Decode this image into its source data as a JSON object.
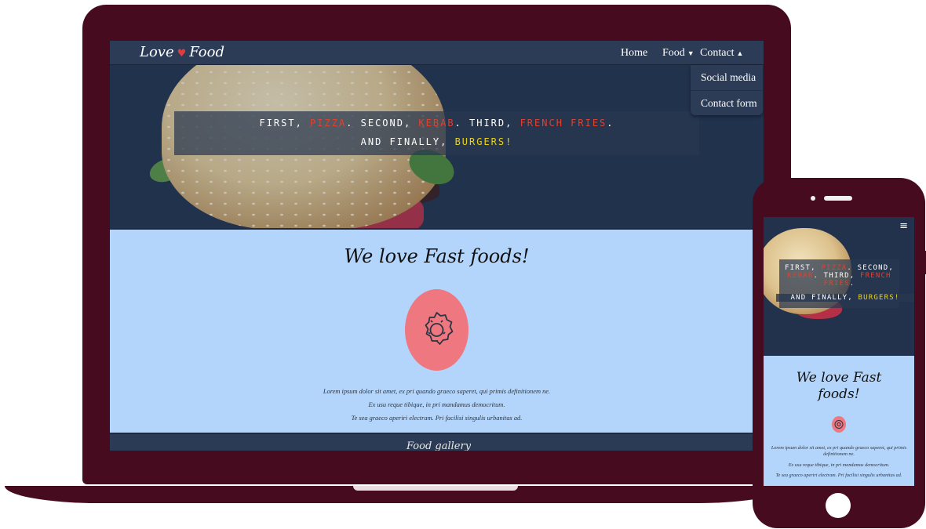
{
  "brand": {
    "left": "Love",
    "heart": "♥",
    "right": "Food"
  },
  "nav": {
    "home": "Home",
    "food": "Food",
    "contact": "Contact",
    "dropdown": [
      "Social media",
      "Contact form"
    ]
  },
  "hero": {
    "quote": {
      "first": "FIRST, ",
      "pizza": "PIZZA",
      "second": ". SECOND, ",
      "kebab": "KEBAB",
      "third": ". THIRD, ",
      "fries": "FRENCH FRIES",
      "period": ".",
      "finally": "AND FINALLY, ",
      "burgers": "BURGERS!"
    }
  },
  "main": {
    "heading": "We love Fast foods!",
    "paragraph": [
      "Lorem ipsum dolor sit amet, ex pri quando graeco saperet, qui primis definitionem ne.",
      "Ex usu reque tibique, in pri mandamus democritum.",
      "Te sea graeco aperiri electram. Pri facilisi singulis urbanitas ad."
    ]
  },
  "footer": {
    "heading": "Food gallery"
  },
  "mobile": {
    "menu_icon": "≡",
    "heading_line1": "We love Fast",
    "heading_line2": "foods!"
  },
  "colors": {
    "frame": "#470b20",
    "nav": "#2c3c57",
    "content_bg": "#b4d5fb",
    "accent_red": "#e0412f",
    "accent_yellow": "#e8d21c",
    "donut": "#ee7780"
  },
  "icons": {
    "heart": "heart-icon",
    "caret": "caret-icon",
    "menu": "hamburger-menu-icon",
    "donut": "donut-icon"
  }
}
